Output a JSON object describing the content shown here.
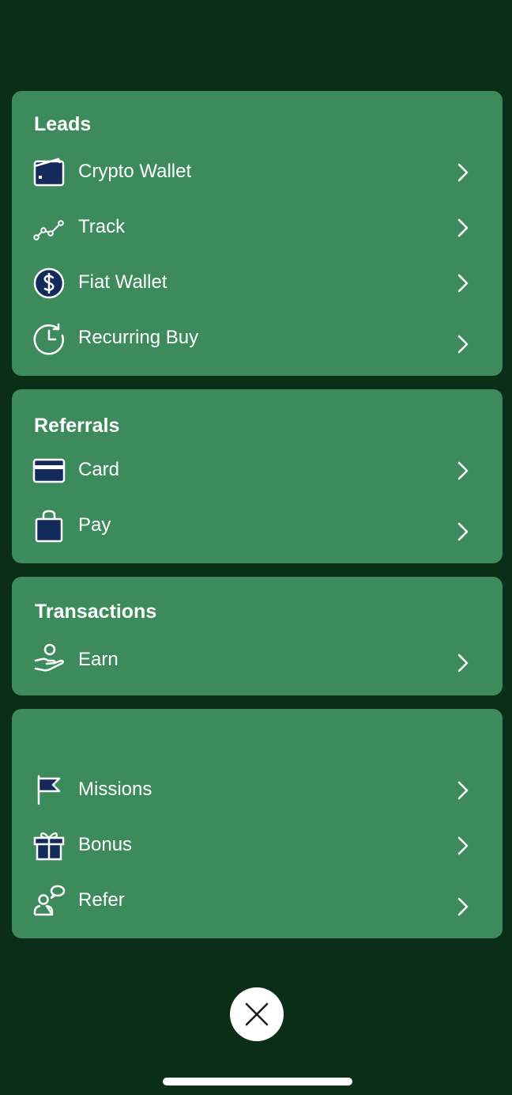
{
  "theme": {
    "background": "#0b2e19",
    "card": "#3d8a5d",
    "icon_color": "#132a5a",
    "text": "#ffffff"
  },
  "sections": {
    "leads": {
      "title": "Leads",
      "items": [
        {
          "label": "Crypto Wallet",
          "icon": "wallet-icon"
        },
        {
          "label": "Track",
          "icon": "trend-line-icon"
        },
        {
          "label": "Fiat Wallet",
          "icon": "dollar-circle-icon"
        },
        {
          "label": "Recurring Buy",
          "icon": "clock-refresh-icon"
        }
      ]
    },
    "referrals": {
      "title": "Referrals",
      "items": [
        {
          "label": "Card",
          "icon": "credit-card-icon"
        },
        {
          "label": "Pay",
          "icon": "shopping-bag-icon"
        }
      ]
    },
    "transactions": {
      "title": "Transactions",
      "items": [
        {
          "label": "Earn",
          "icon": "hand-coin-icon"
        }
      ]
    },
    "more": {
      "items": [
        {
          "label": "Missions",
          "icon": "flag-icon"
        },
        {
          "label": "Bonus",
          "icon": "gift-icon"
        },
        {
          "label": "Refer",
          "icon": "person-speech-icon"
        }
      ]
    }
  },
  "close_button": {
    "icon": "close-icon"
  }
}
